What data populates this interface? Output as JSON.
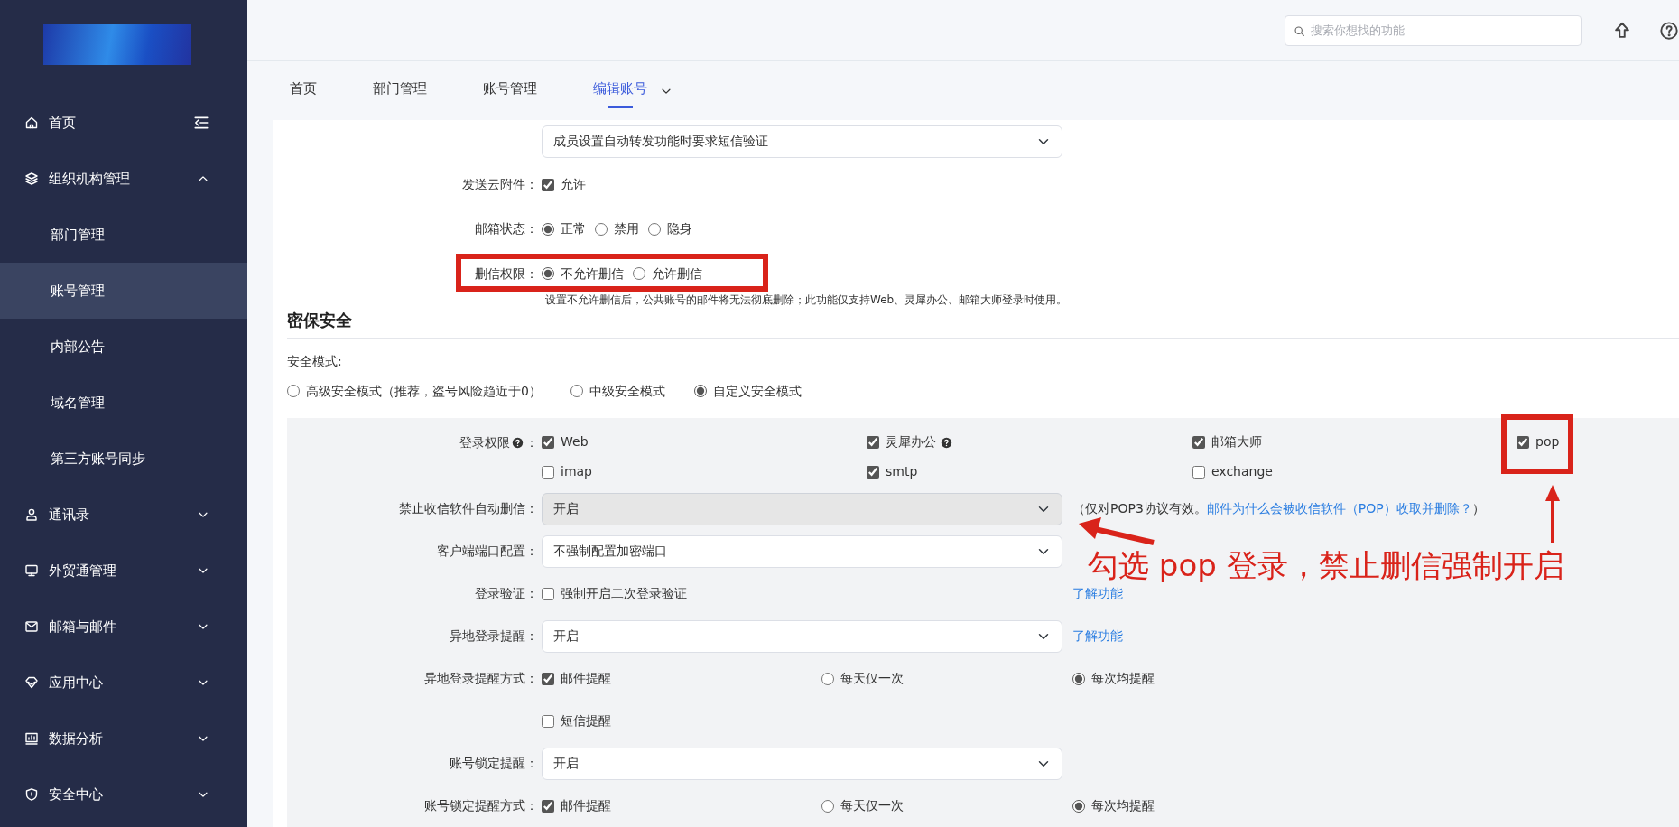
{
  "sidebar": {
    "items": [
      {
        "kind": "link",
        "label": "首页"
      },
      {
        "kind": "group",
        "label": "组织机构管理",
        "expanded": true,
        "children": [
          {
            "label": "部门管理",
            "selected": false
          },
          {
            "label": "账号管理",
            "selected": true
          },
          {
            "label": "内部公告",
            "selected": false
          },
          {
            "label": "域名管理",
            "selected": false
          },
          {
            "label": "第三方账号同步",
            "selected": false
          }
        ]
      },
      {
        "kind": "group",
        "label": "通讯录",
        "expanded": false
      },
      {
        "kind": "group",
        "label": "外贸通管理",
        "expanded": false
      },
      {
        "kind": "group",
        "label": "邮箱与邮件",
        "expanded": false
      },
      {
        "kind": "group",
        "label": "应用中心",
        "expanded": false
      },
      {
        "kind": "group",
        "label": "数据分析",
        "expanded": false
      },
      {
        "kind": "group",
        "label": "安全中心",
        "expanded": false
      }
    ]
  },
  "topbar": {
    "search": {
      "placeholder": "搜索你想找的功能"
    }
  },
  "tabs": [
    {
      "label": "首页",
      "selected": false
    },
    {
      "label": "部门管理",
      "selected": false
    },
    {
      "label": "账号管理",
      "selected": false
    },
    {
      "label": "编辑账号",
      "selected": true
    }
  ],
  "fields": [
    {
      "kind": "select",
      "value": "成员设置自动转发功能时要求短信验证",
      "disabled": false
    },
    {
      "kind": "checks",
      "label": "发送云附件：",
      "options": [
        {
          "label": "允许",
          "checked": true
        }
      ]
    },
    {
      "kind": "radios",
      "label": "邮箱状态：",
      "options": [
        {
          "label": "正常",
          "selected": true
        },
        {
          "label": "禁用",
          "selected": false
        },
        {
          "label": "隐身",
          "selected": false
        }
      ]
    },
    {
      "kind": "radios",
      "label": "删信权限：",
      "highlighted": true,
      "options": [
        {
          "label": "不允许删信",
          "selected": true
        },
        {
          "label": "允许删信",
          "selected": false
        }
      ],
      "help": "设置不允许删信后，公共账号的邮件将无法彻底删除；此功能仅支持Web、灵犀办公、邮箱大师登录时使用。"
    }
  ],
  "section": {
    "title": "密保安全",
    "mode_label": "安全模式:",
    "modes": [
      {
        "label": "高级安全模式（推荐，盗号风险趋近于0）",
        "selected": false
      },
      {
        "label": "中级安全模式",
        "selected": false
      },
      {
        "label": "自定义安全模式",
        "selected": true
      }
    ]
  },
  "panel": [
    {
      "kind": "grid",
      "label": "登录权限",
      "label_end": "：",
      "options": [
        {
          "label": "Web",
          "checked": true,
          "help_icon": false,
          "highlighted": false
        },
        {
          "label": "灵犀办公",
          "checked": true,
          "help_icon": true,
          "highlighted": false
        },
        {
          "label": "邮箱大师",
          "checked": true,
          "help_icon": false,
          "highlighted": false
        },
        {
          "label": "pop",
          "checked": true,
          "help_icon": false,
          "highlighted": true
        },
        {
          "label": "imap",
          "checked": false,
          "help_icon": false,
          "highlighted": false
        },
        {
          "label": "smtp",
          "checked": true,
          "help_icon": false,
          "highlighted": false
        },
        {
          "label": "exchange",
          "checked": false,
          "help_icon": false,
          "highlighted": false
        }
      ]
    },
    {
      "kind": "select",
      "label": "禁止收信软件自动删信：",
      "value": "开启",
      "disabled": true,
      "note": "（仅对POP3协议有效。",
      "link": "邮件为什么会被收信软件（POP）收取并删除？",
      "note_end": "）"
    },
    {
      "kind": "select",
      "label": "客户端端口配置：",
      "value": "不强制配置加密端口",
      "disabled": false
    },
    {
      "kind": "checks",
      "label": "登录验证：",
      "options": [
        {
          "label": "强制开启二次登录验证",
          "checked": false
        }
      ],
      "link": "了解功能"
    },
    {
      "kind": "select",
      "label": "异地登录提醒：",
      "value": "开启",
      "disabled": false,
      "link": "了解功能"
    },
    {
      "kind": "notify",
      "label": "异地登录提醒方式：",
      "check": {
        "label": "邮件提醒",
        "checked": true
      },
      "options": [
        {
          "label": "每天仅一次",
          "selected": false
        },
        {
          "label": "每次均提醒",
          "selected": true
        }
      ]
    },
    {
      "kind": "checks",
      "options": [
        {
          "label": "短信提醒",
          "checked": false
        }
      ]
    },
    {
      "kind": "select",
      "label": "账号锁定提醒：",
      "value": "开启",
      "disabled": false
    },
    {
      "kind": "notify",
      "label": "账号锁定提醒方式：",
      "check": {
        "label": "邮件提醒",
        "checked": true
      },
      "options": [
        {
          "label": "每天仅一次",
          "selected": false
        },
        {
          "label": "每次均提醒",
          "selected": true
        }
      ]
    }
  ],
  "annotation": {
    "callout": "勾选 pop 登录，禁止删信强制开启"
  }
}
